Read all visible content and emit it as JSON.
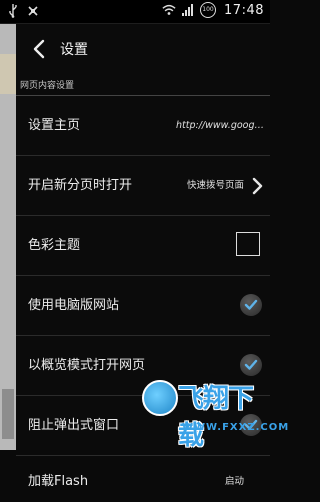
{
  "status_bar": {
    "time": "17:48",
    "battery_level": "100",
    "left_icons": [
      "usb-icon",
      "debug-icon"
    ],
    "right_icons": [
      "wifi-icon",
      "signal-icon",
      "battery-icon"
    ]
  },
  "header": {
    "title": "设置",
    "back_icon": "chevron-left-icon"
  },
  "section": {
    "title": "网页内容设置"
  },
  "settings": [
    {
      "label": "设置主页",
      "value": "http://www.google.c..."
    },
    {
      "label": "开启新分页时打开",
      "value": "快速拨号页面"
    },
    {
      "label": "色彩主题",
      "checked": false
    },
    {
      "label": "使用电脑版网站",
      "checked": true
    },
    {
      "label": "以概览模式打开网页",
      "checked": true
    },
    {
      "label": "阻止弹出式窗口",
      "checked": true
    },
    {
      "label": "加载Flash",
      "value": "启动"
    }
  ],
  "watermark": {
    "brand": "飞翔下载",
    "url": "WWW.FXXZ.COM"
  },
  "colors": {
    "background": "#0b0b0b",
    "text": "#ececec",
    "divider": "#2b2b2b",
    "watermark": "#3aa2e8"
  }
}
